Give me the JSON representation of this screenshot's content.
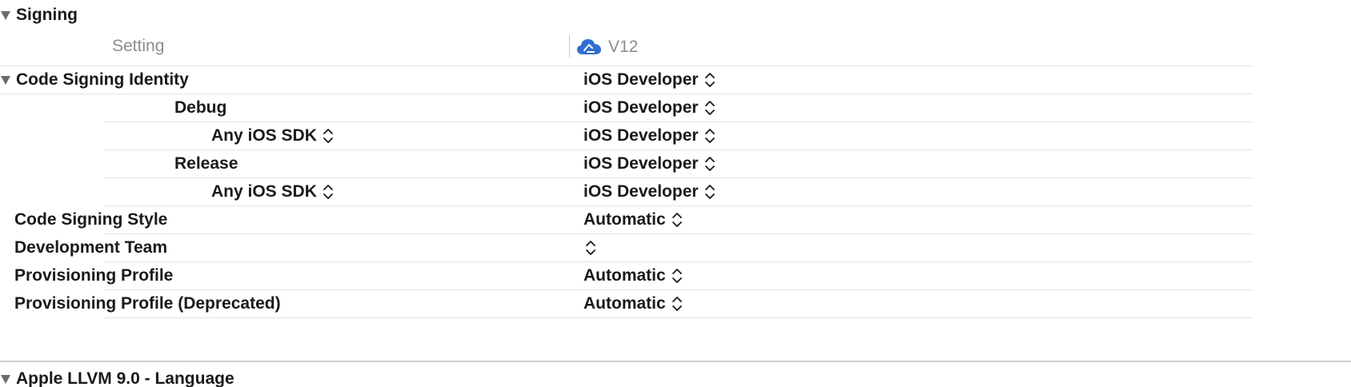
{
  "signing_section": {
    "title": "Signing"
  },
  "columns": {
    "setting": "Setting",
    "target": "V12",
    "target_icon": "cloud-app-target-icon",
    "target_icon_color": "#2f6fd0"
  },
  "rows": [
    {
      "name": "Code Signing Identity",
      "value": "iOS Developer",
      "expandable": true
    },
    {
      "name": "Debug",
      "value": "iOS Developer"
    },
    {
      "name": "Any iOS SDK",
      "value": "iOS Developer",
      "name_stepper": true
    },
    {
      "name": "Release",
      "value": "iOS Developer"
    },
    {
      "name": "Any iOS SDK",
      "value": "iOS Developer",
      "name_stepper": true
    },
    {
      "name": "Code Signing Style",
      "value": "Automatic"
    },
    {
      "name": "Development Team",
      "value": ""
    },
    {
      "name": "Provisioning Profile",
      "value": "Automatic"
    },
    {
      "name": "Provisioning Profile (Deprecated)",
      "value": "Automatic"
    }
  ],
  "next_section": {
    "title": "Apple LLVM 9.0 - Language"
  }
}
